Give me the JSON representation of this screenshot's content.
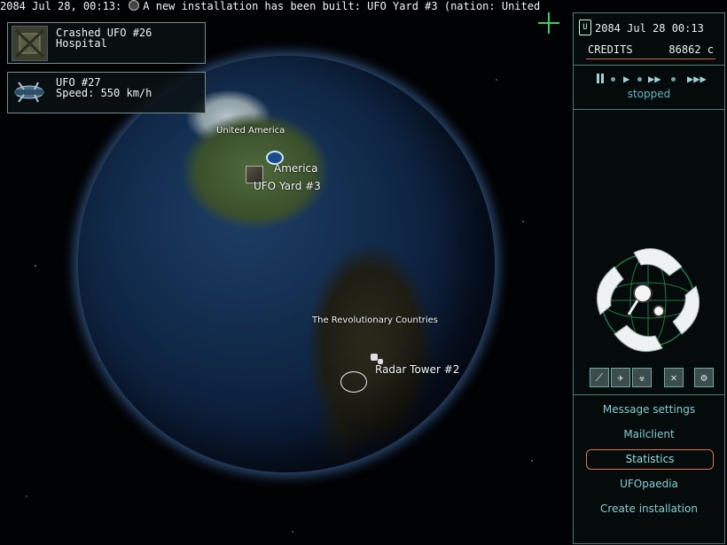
{
  "news_ticker": {
    "timestamp": "2084 Jul 28, 00:13:",
    "message": "A new installation has been built: UFO Yard #3 (nation: United"
  },
  "cards": [
    {
      "line1": "Crashed UFO #26",
      "line2": "Hospital",
      "icon": "crashed-ufo-icon"
    },
    {
      "line1": "UFO #27",
      "line2": "Speed: 550 km/h",
      "icon": "ufo-icon"
    }
  ],
  "globe": {
    "labels": {
      "nation_north": "United America",
      "base_america": "America",
      "ufo_yard": "UFO Yard #3",
      "nation_south": "The Revolutionary Countries",
      "radar_tower": "Radar Tower #2"
    }
  },
  "panel": {
    "date": "2084 Jul 28 00:13",
    "credits_label": "CREDITS",
    "credits_value": "86862 c",
    "time_status": "stopped",
    "menu": [
      "Message settings",
      "Mailclient",
      "Statistics",
      "UFOpaedia",
      "Create installation"
    ],
    "active_menu": "Statistics"
  },
  "colors": {
    "accent": "#4b7a78",
    "menu_text": "#7ecfd3",
    "highlight": "#d8763f",
    "crosshair": "#2fd25a"
  }
}
